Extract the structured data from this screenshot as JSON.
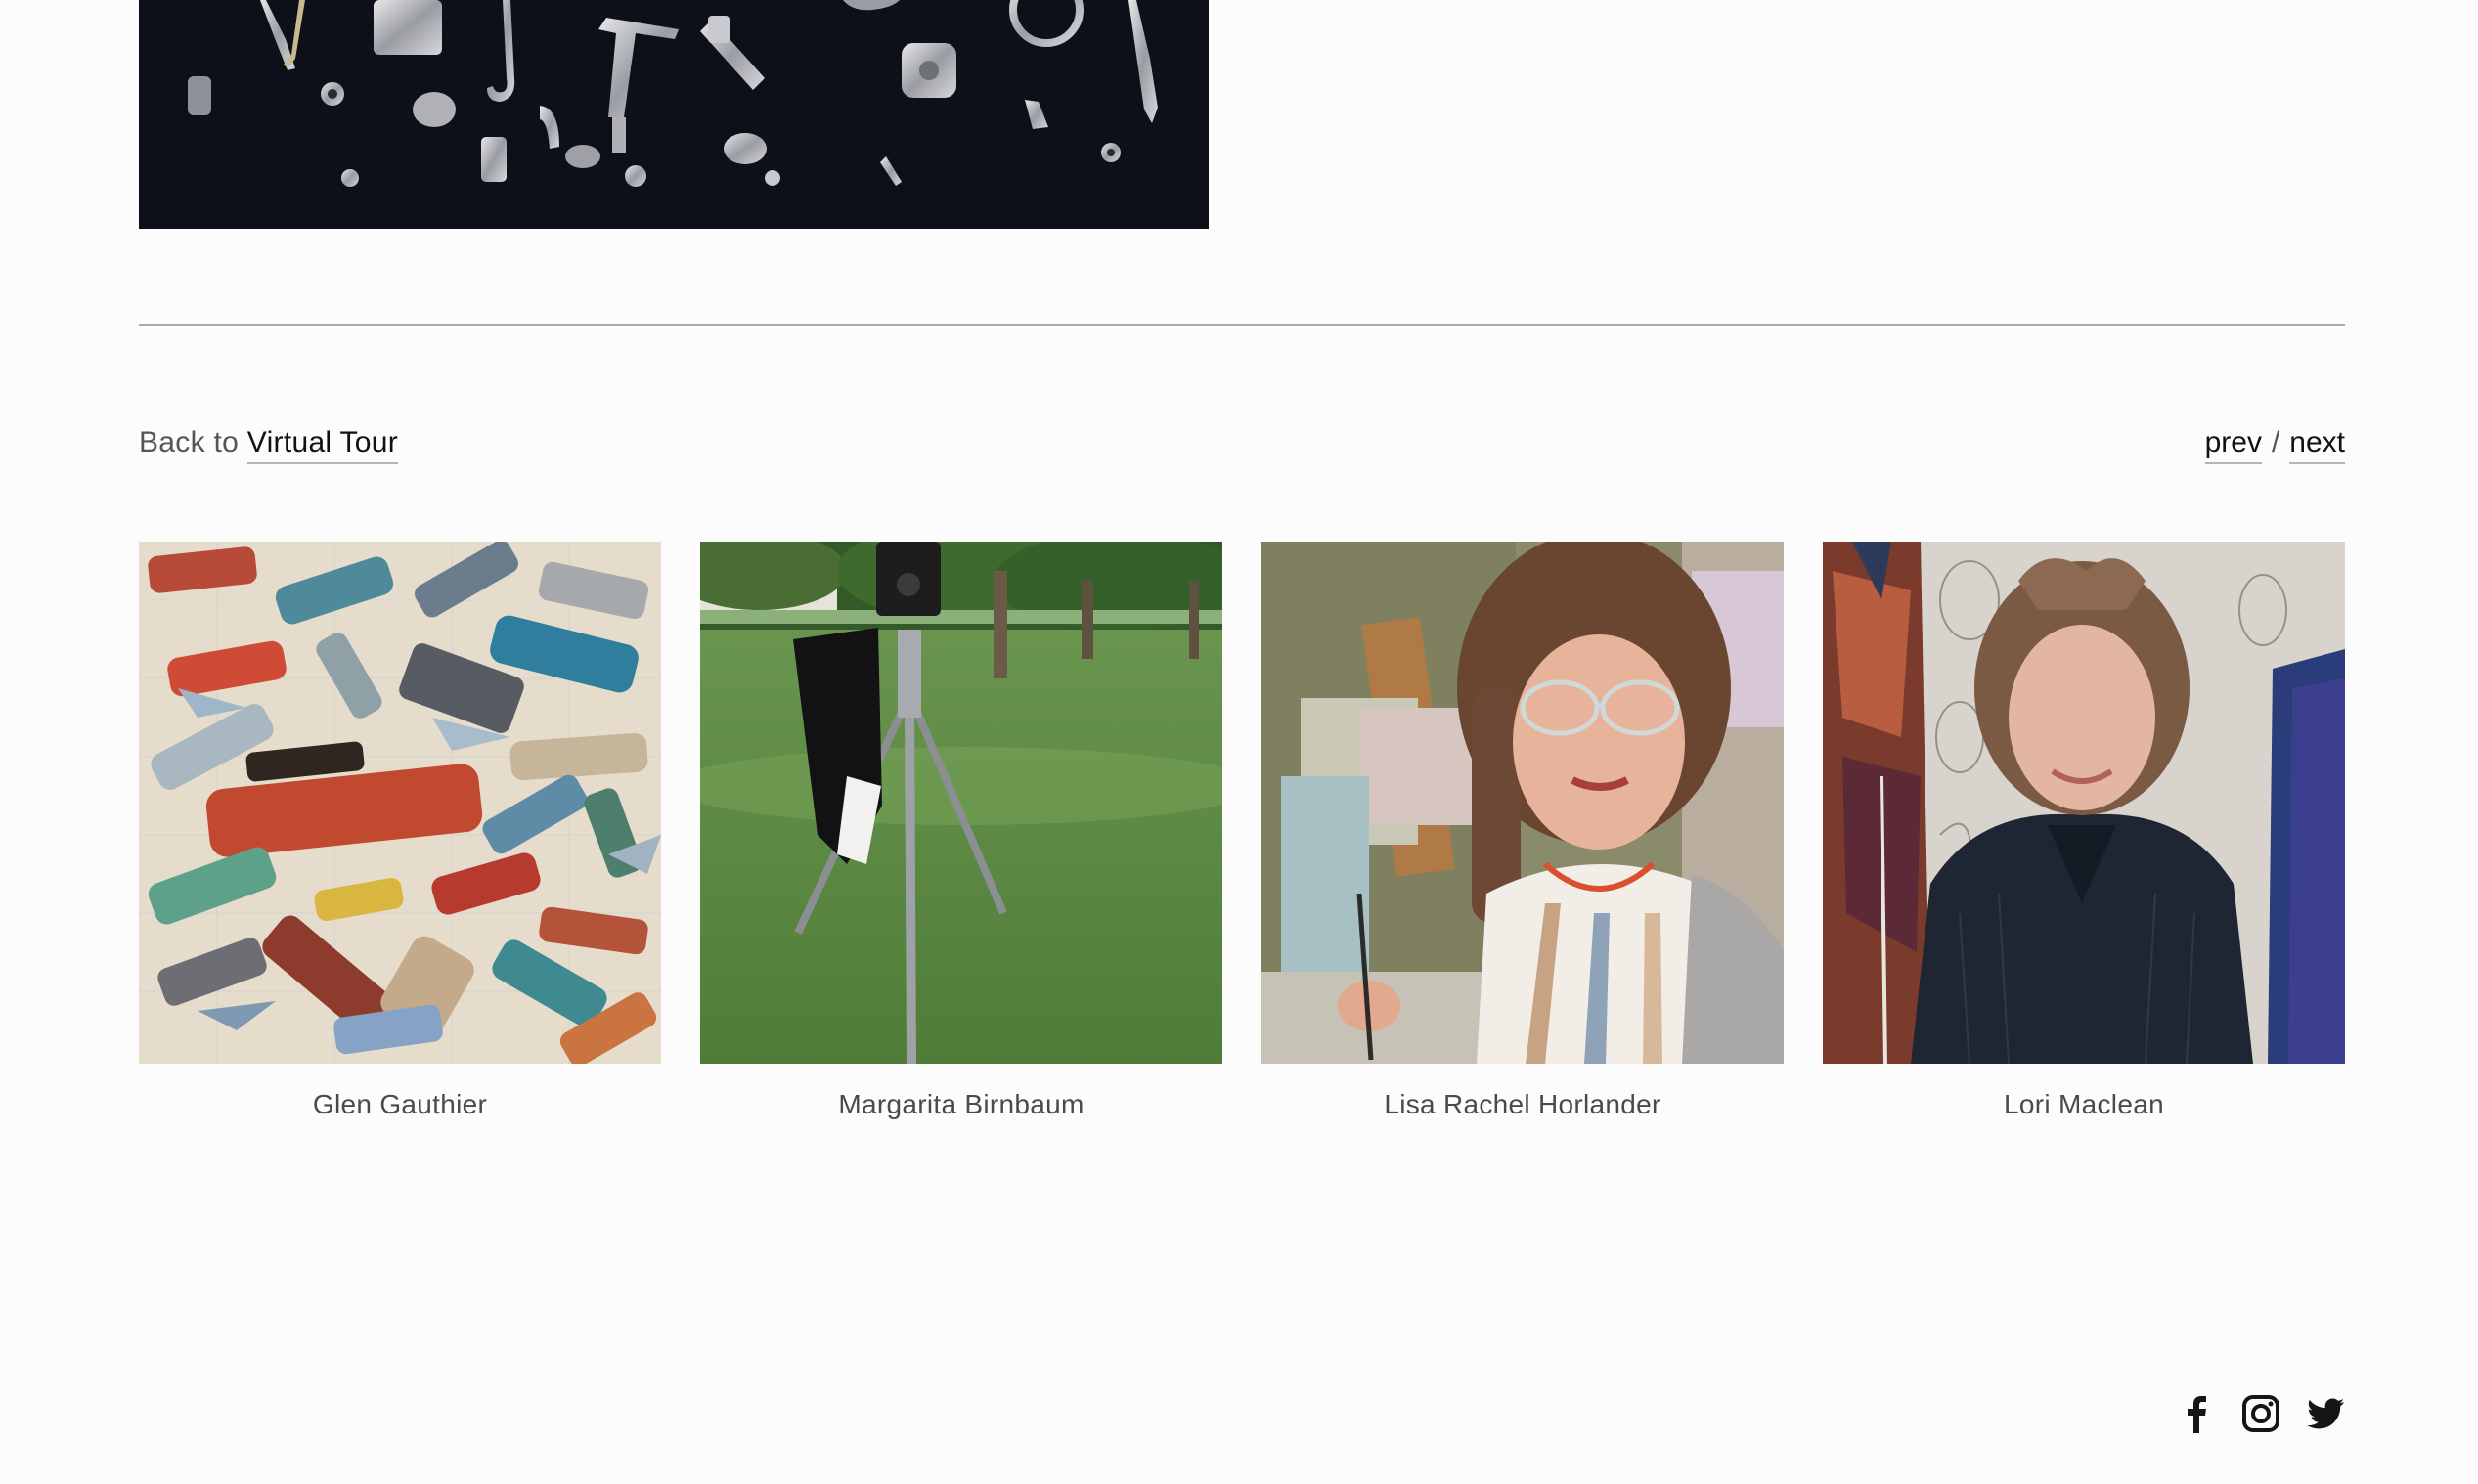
{
  "navigation": {
    "back_prefix": "Back to",
    "back_link": "Virtual Tour",
    "prev_label": "prev",
    "separator": "/",
    "next_label": "next"
  },
  "artists": [
    {
      "name": "Glen Gauthier",
      "image_icon": "car-collage-image"
    },
    {
      "name": "Margarita Birnbaum",
      "image_icon": "camera-tripod-image"
    },
    {
      "name": "Lisa Rachel Horlander",
      "image_icon": "artist-portrait-image"
    },
    {
      "name": "Lori Maclean",
      "image_icon": "artist-portrait-image"
    }
  ],
  "social": [
    "facebook-icon",
    "instagram-icon",
    "twitter-icon"
  ],
  "colors": {
    "background": "#fcfcfc",
    "text": "#1a1a1a",
    "caption": "#4a4a4a",
    "divider": "#a9a9a9"
  }
}
